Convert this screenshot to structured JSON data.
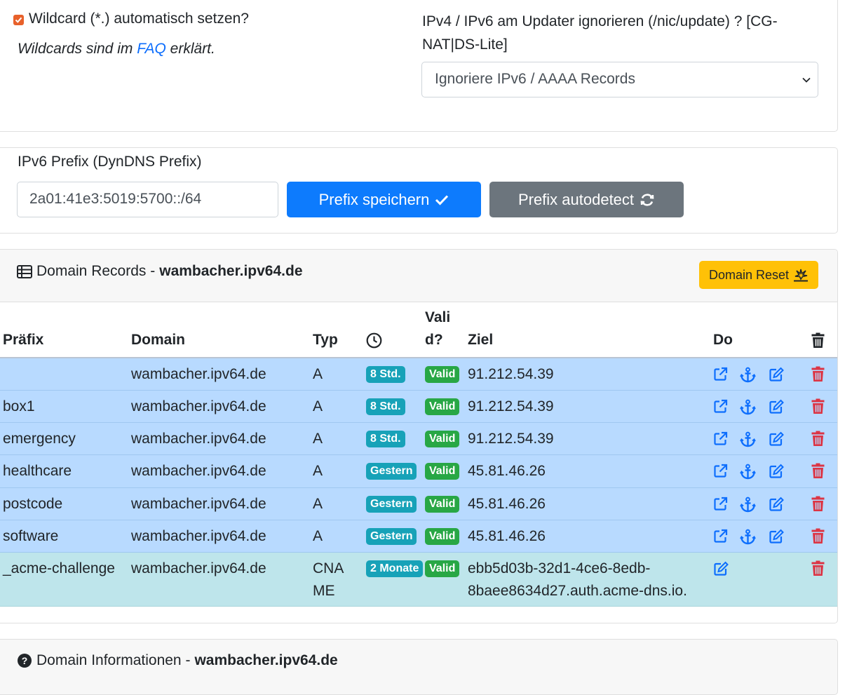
{
  "wildcard": {
    "checked": true,
    "label": "Wildcard (*.) automatisch setzen?",
    "note_prefix": "Wildcards sind im",
    "note_link": "FAQ",
    "note_suffix": "erklärt."
  },
  "ipv_ignore": {
    "label": "IPv4 / IPv6 am Updater ignorieren (/nic/update) ? [CG-NAT|DS-Lite]",
    "selected": "Ignoriere IPv6 / AAAA Records"
  },
  "prefix": {
    "label": "IPv6 Prefix (DynDNS Prefix)",
    "value": "2a01:41e3:5019:5700::/64",
    "save_label": "Prefix speichern",
    "autodetect_label": "Prefix autodetect"
  },
  "domain_records": {
    "title_prefix": "Domain Records -",
    "domain": "wambacher.ipv64.de",
    "reset_label": "Domain Reset",
    "headers": {
      "prefix": "Präfix",
      "domain": "Domain",
      "type": "Typ",
      "valid_line1": "Vali",
      "valid_line2": "d?",
      "target": "Ziel",
      "do": "Do"
    },
    "rows": [
      {
        "prefix": "",
        "domain": "wambacher.ipv64.de",
        "type": "A",
        "type2": "",
        "age": "8 Std.",
        "valid": "Valid",
        "target": "91.212.54.39",
        "target2": ""
      },
      {
        "prefix": "box1",
        "domain": "wambacher.ipv64.de",
        "type": "A",
        "type2": "",
        "age": "8 Std.",
        "valid": "Valid",
        "target": "91.212.54.39",
        "target2": ""
      },
      {
        "prefix": "emergency",
        "domain": "wambacher.ipv64.de",
        "type": "A",
        "type2": "",
        "age": "8 Std.",
        "valid": "Valid",
        "target": "91.212.54.39",
        "target2": ""
      },
      {
        "prefix": "healthcare",
        "domain": "wambacher.ipv64.de",
        "type": "A",
        "type2": "",
        "age": "Gestern",
        "valid": "Valid",
        "target": "45.81.46.26",
        "target2": ""
      },
      {
        "prefix": "postcode",
        "domain": "wambacher.ipv64.de",
        "type": "A",
        "type2": "",
        "age": "Gestern",
        "valid": "Valid",
        "target": "45.81.46.26",
        "target2": ""
      },
      {
        "prefix": "software",
        "domain": "wambacher.ipv64.de",
        "type": "A",
        "type2": "",
        "age": "Gestern",
        "valid": "Valid",
        "target": "45.81.46.26",
        "target2": ""
      },
      {
        "prefix": "_acme-challenge",
        "domain": "wambacher.ipv64.de",
        "type": "CNA",
        "type2": "ME",
        "age": "2 Monate",
        "valid": "Valid",
        "target": "ebb5d03b-32d1-4ce6-8edb-",
        "target2": "8baee8634d27.auth.acme-dns.io."
      }
    ]
  },
  "domain_info": {
    "title_prefix": "Domain Informationen -",
    "domain": "wambacher.ipv64.de"
  },
  "colors": {
    "primary": "#0d7bfd",
    "secondary": "#6c757d",
    "warning": "#ffc107",
    "row_a": "#b8daff",
    "row_cname": "#bee5eb",
    "badge_age": "#17a2b8",
    "badge_valid": "#28a745",
    "action_blue": "#0d6efd",
    "delete_red": "#dc3545"
  }
}
